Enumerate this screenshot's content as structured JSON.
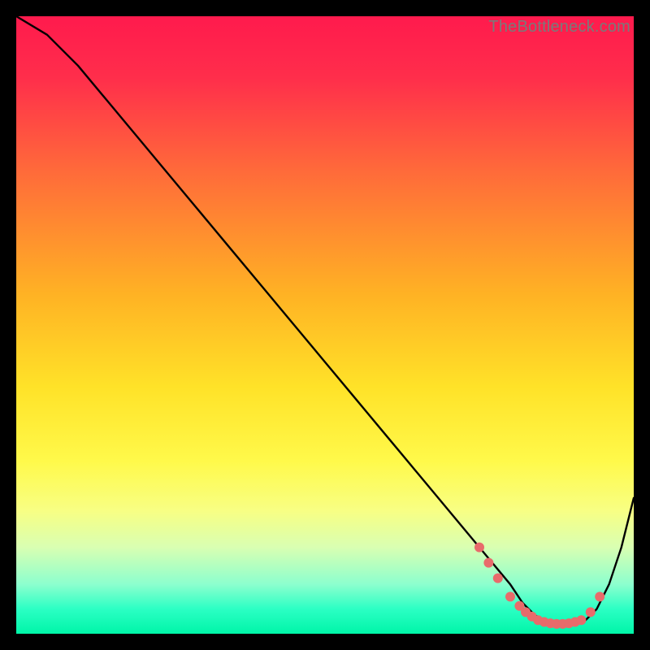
{
  "watermark": "TheBottleneck.com",
  "chart_data": {
    "type": "line",
    "title": "",
    "xlabel": "",
    "ylabel": "",
    "xlim": [
      0,
      100
    ],
    "ylim": [
      0,
      100
    ],
    "grid": false,
    "series": [
      {
        "name": "curve",
        "x": [
          0,
          5,
          10,
          15,
          20,
          25,
          30,
          35,
          40,
          45,
          50,
          55,
          60,
          65,
          70,
          75,
          80,
          82,
          84,
          86,
          88,
          90,
          92,
          94,
          96,
          98,
          100
        ],
        "y": [
          100,
          97,
          92,
          86,
          80,
          74,
          68,
          62,
          56,
          50,
          44,
          38,
          32,
          26,
          20,
          14,
          8,
          5,
          3,
          2,
          1.5,
          1.5,
          2,
          4,
          8,
          14,
          22
        ],
        "color": "#000000"
      }
    ],
    "markers": {
      "name": "dots",
      "x": [
        75,
        76.5,
        78,
        80,
        81.5,
        82.5,
        83.5,
        84.5,
        85.5,
        86.5,
        87.5,
        88.5,
        89.5,
        90.5,
        91.5,
        93,
        94.5
      ],
      "y": [
        14,
        11.5,
        9,
        6,
        4.5,
        3.5,
        2.8,
        2.2,
        1.9,
        1.7,
        1.6,
        1.6,
        1.7,
        1.9,
        2.2,
        3.5,
        6
      ],
      "color": "#e86b6b"
    },
    "background_gradient": {
      "stops": [
        {
          "offset": 0.0,
          "color": "#ff1a4d"
        },
        {
          "offset": 0.1,
          "color": "#ff2e4b"
        },
        {
          "offset": 0.25,
          "color": "#ff6a3a"
        },
        {
          "offset": 0.45,
          "color": "#ffb224"
        },
        {
          "offset": 0.6,
          "color": "#ffe228"
        },
        {
          "offset": 0.72,
          "color": "#fff94a"
        },
        {
          "offset": 0.8,
          "color": "#f8ff83"
        },
        {
          "offset": 0.86,
          "color": "#d9ffb2"
        },
        {
          "offset": 0.92,
          "color": "#8cffce"
        },
        {
          "offset": 0.96,
          "color": "#2bffc4"
        },
        {
          "offset": 1.0,
          "color": "#00f5a8"
        }
      ]
    }
  }
}
